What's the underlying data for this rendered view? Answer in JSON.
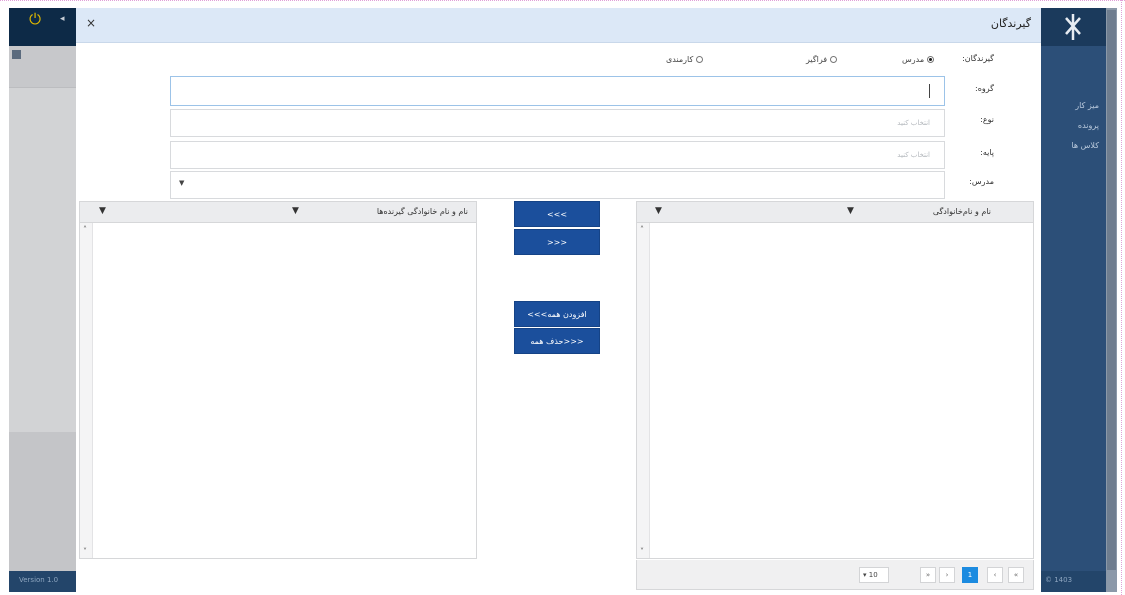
{
  "dialog": {
    "title": "گیرندگان",
    "close_glyph": "×"
  },
  "audience": {
    "label": "گیرندگان:",
    "options": [
      {
        "label": "مدرس",
        "checked": true
      },
      {
        "label": "فراگیر",
        "checked": false
      },
      {
        "label": "کارمندی",
        "checked": false
      }
    ]
  },
  "fields": {
    "group": {
      "label": "گروه:",
      "value": ""
    },
    "type": {
      "label": "نوع:",
      "placeholder": "انتخاب کنید"
    },
    "grade": {
      "label": "پایه:",
      "placeholder": "انتخاب کنید"
    },
    "school": {
      "label": "مدرس:",
      "value": ""
    }
  },
  "grids": {
    "left": {
      "column_title": "نام و نام خانوادگی گیرنده‌ها"
    },
    "right": {
      "column_title": "نام و نام‌خانوادگی"
    }
  },
  "buttons": {
    "move_right": ">>>",
    "move_left": "<<<",
    "add_all": "افزودن همه>>>",
    "remove_all": "<<<حذف همه"
  },
  "pager": {
    "page_size": "10",
    "current_page": "1",
    "first": "«",
    "prev": "‹",
    "next": "›",
    "last": "»"
  },
  "background_app": {
    "nav_items": [
      "میز کار",
      "پرونده",
      "کلاس ها"
    ],
    "footer_left": "Version 1.0",
    "footer_right": "© 1403"
  },
  "icons": {
    "power": "power-icon",
    "close": "close-icon",
    "filter": "filter-icon",
    "logo": "logo-icon"
  },
  "colors": {
    "header_bg": "#dce8f7",
    "button_bg": "#1b4f9c",
    "pager_active": "#1c8be0",
    "sidebar_bg": "#2c4f78"
  }
}
